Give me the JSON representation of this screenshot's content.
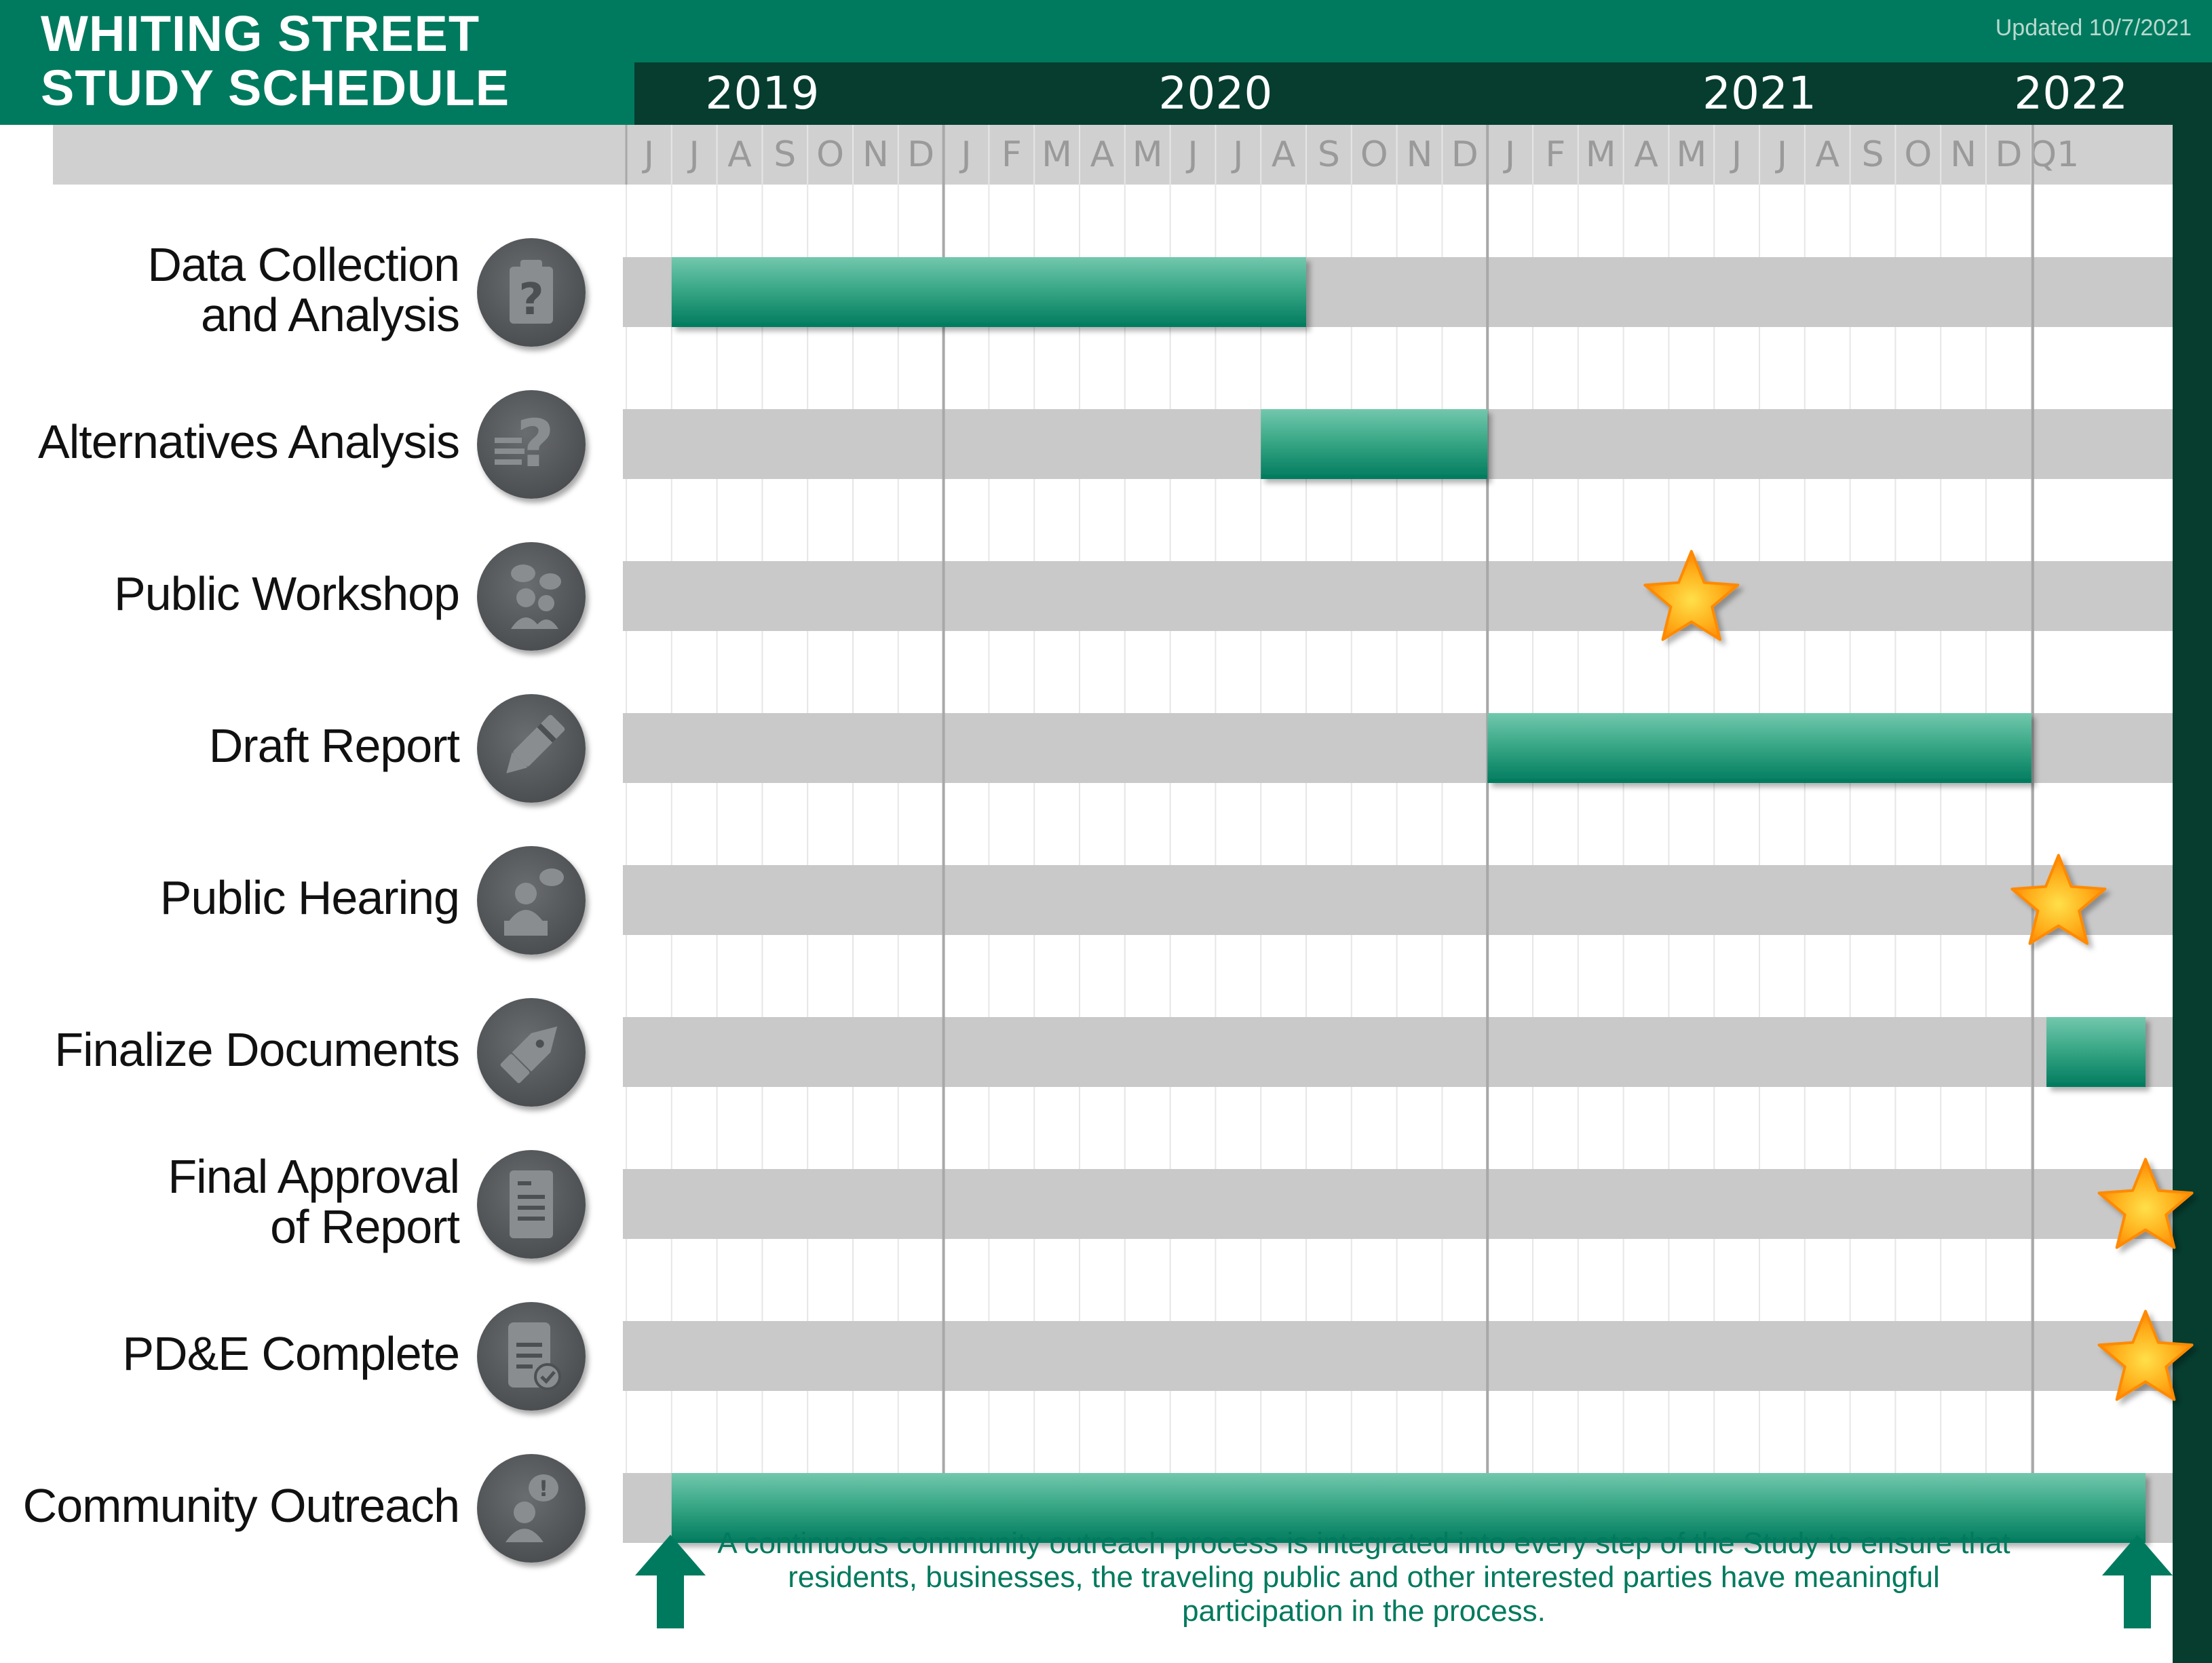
{
  "header": {
    "title_line1": "WHITING STREET",
    "title_line2": "STUDY SCHEDULE",
    "updated": "Updated 10/7/2021"
  },
  "colors": {
    "header_green": "#007a5e",
    "year_bar": "#063d2f",
    "bar_top": "#6cc3a8",
    "bar_bottom": "#007a5e",
    "row_band": "#c9c9c9",
    "star_fill": "#ffa000",
    "arrow": "#007a5e"
  },
  "icons": [
    "clipboard-question-icon",
    "question-icon",
    "workshop-people-icon",
    "draft-pen-icon",
    "public-hearing-icon",
    "finalize-pen-icon",
    "document-approval-icon",
    "complete-document-icon",
    "community-outreach-icon"
  ],
  "chart_data": {
    "type": "gantt",
    "years": [
      {
        "label": "2019",
        "position_month": "2019-09"
      },
      {
        "label": "2020",
        "position_month": "2020-07"
      },
      {
        "label": "2021",
        "position_month": "2021-07"
      },
      {
        "label": "2022",
        "position_month": "2022-Q1"
      }
    ],
    "months": [
      "J",
      "J",
      "A",
      "S",
      "O",
      "N",
      "D",
      "J",
      "F",
      "M",
      "A",
      "M",
      "J",
      "J",
      "A",
      "S",
      "O",
      "N",
      "D",
      "J",
      "F",
      "M",
      "A",
      "M",
      "J",
      "J",
      "A",
      "S",
      "O",
      "N",
      "D",
      "Q1"
    ],
    "month_dates": [
      "2019-06",
      "2019-07",
      "2019-08",
      "2019-09",
      "2019-10",
      "2019-11",
      "2019-12",
      "2020-01",
      "2020-02",
      "2020-03",
      "2020-04",
      "2020-05",
      "2020-06",
      "2020-07",
      "2020-08",
      "2020-09",
      "2020-10",
      "2020-11",
      "2020-12",
      "2021-01",
      "2021-02",
      "2021-03",
      "2021-04",
      "2021-05",
      "2021-06",
      "2021-07",
      "2021-08",
      "2021-09",
      "2021-10",
      "2021-11",
      "2021-12",
      "2022-Q1"
    ],
    "tasks": [
      {
        "label": "Data Collection\nand Analysis",
        "kind": "bar",
        "start": "2019-07",
        "end": "2020-08"
      },
      {
        "label": "Alternatives Analysis",
        "kind": "bar",
        "start": "2020-08",
        "end": "2020-12"
      },
      {
        "label": "Public Workshop",
        "kind": "milestone",
        "at": "2021-05"
      },
      {
        "label": "Draft  Report",
        "kind": "bar",
        "start": "2021-01",
        "end": "2021-12"
      },
      {
        "label": "Public Hearing",
        "kind": "milestone",
        "at": "2022-01"
      },
      {
        "label": "Finalize Documents",
        "kind": "bar",
        "start": "2022-02",
        "end": "2022-03"
      },
      {
        "label": "Final  Approval\nof Report",
        "kind": "milestone",
        "at": "2022-03"
      },
      {
        "label": "PD&E Complete",
        "kind": "milestone",
        "at": "2022-03"
      },
      {
        "label": "Community Outreach",
        "kind": "bar",
        "start": "2019-07",
        "end": "2022-03"
      }
    ]
  },
  "note": "A continuous community outreach process is integrated into every step of the Study to ensure that residents, businesses, the traveling public and other interested parties have meaningful participation in the process."
}
